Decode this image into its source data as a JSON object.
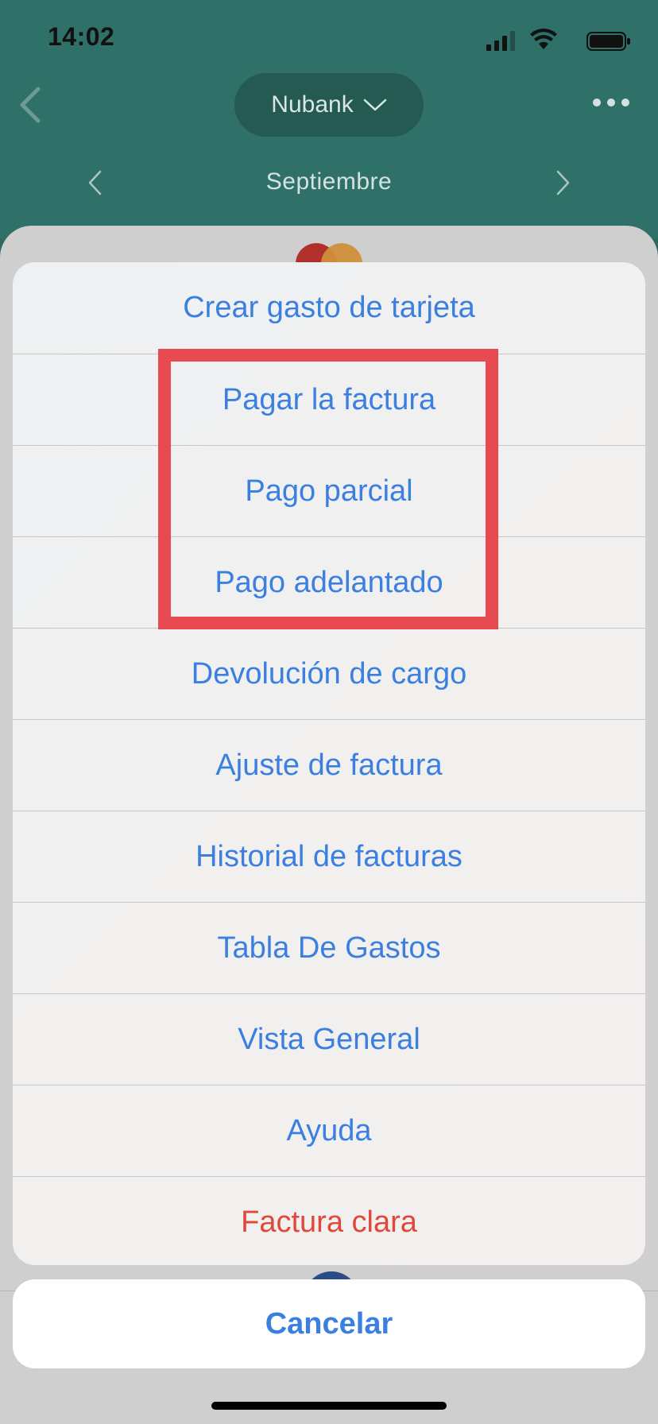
{
  "status_bar": {
    "time": "14:02"
  },
  "header": {
    "account_name": "Nubank",
    "month": "Septiembre"
  },
  "action_sheet": {
    "items": [
      {
        "label": "Crear gasto de tarjeta"
      },
      {
        "label": "Pagar la factura"
      },
      {
        "label": "Pago parcial"
      },
      {
        "label": "Pago adelantado"
      },
      {
        "label": "Devolución de cargo"
      },
      {
        "label": "Ajuste de factura"
      },
      {
        "label": "Historial de facturas"
      },
      {
        "label": "Tabla De Gastos"
      },
      {
        "label": "Vista General"
      },
      {
        "label": "Ayuda"
      },
      {
        "label": "Factura clara",
        "style": "destructive"
      }
    ],
    "cancel_label": "Cancelar"
  },
  "colors": {
    "header_bg": "#2f7169",
    "action_text": "#3b7fe0",
    "destructive_text": "#e0483b",
    "highlight_border": "#e84a52"
  }
}
